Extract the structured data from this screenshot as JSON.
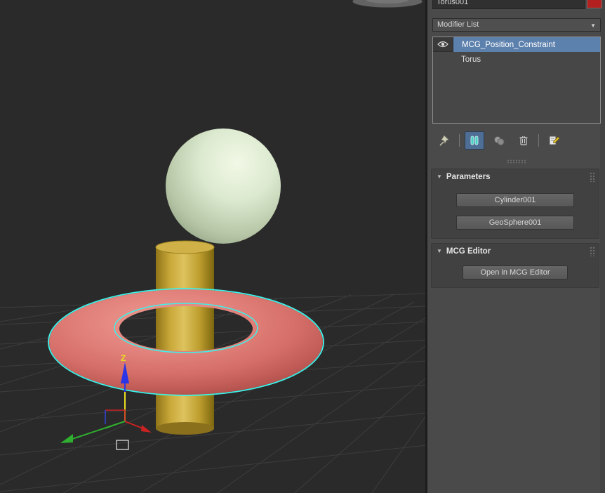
{
  "colors": {
    "selection_blue": "#5d81ad",
    "swatch_red": "#b2201f",
    "torus": "#d56e68",
    "cylinder": "#c7a42f",
    "sphere": "#dcead0",
    "selection_outline": "#3cf2e9"
  },
  "viewport": {
    "axis_z_label": "Z"
  },
  "panel": {
    "name_field": {
      "value": "Torus001"
    },
    "modifier_list": {
      "label": "Modifier List",
      "arrow": "▼"
    },
    "stack": {
      "rows": [
        {
          "label": "MCG_Position_Constraint",
          "selected": true
        },
        {
          "label": "Torus",
          "selected": false
        }
      ]
    },
    "toolbar": {
      "items": [
        {
          "name": "pin-stack",
          "icon": "pin-icon",
          "active": false
        },
        {
          "name": "show-end-result",
          "icon": "show-end-result-icon",
          "active": true
        },
        {
          "name": "make-unique",
          "icon": "make-unique-icon",
          "active": false
        },
        {
          "name": "remove-modifier",
          "icon": "trash-icon",
          "active": false
        },
        {
          "name": "configure-modifier-sets",
          "icon": "configure-sets-icon",
          "active": false
        }
      ]
    },
    "rollouts": [
      {
        "title": "Parameters",
        "arrow": "▼",
        "buttons": [
          {
            "label": "Cylinder001"
          },
          {
            "label": "GeoSphere001"
          }
        ]
      },
      {
        "title": "MCG Editor",
        "arrow": "▼",
        "buttons": [
          {
            "label": "Open in MCG Editor"
          }
        ]
      }
    ]
  }
}
